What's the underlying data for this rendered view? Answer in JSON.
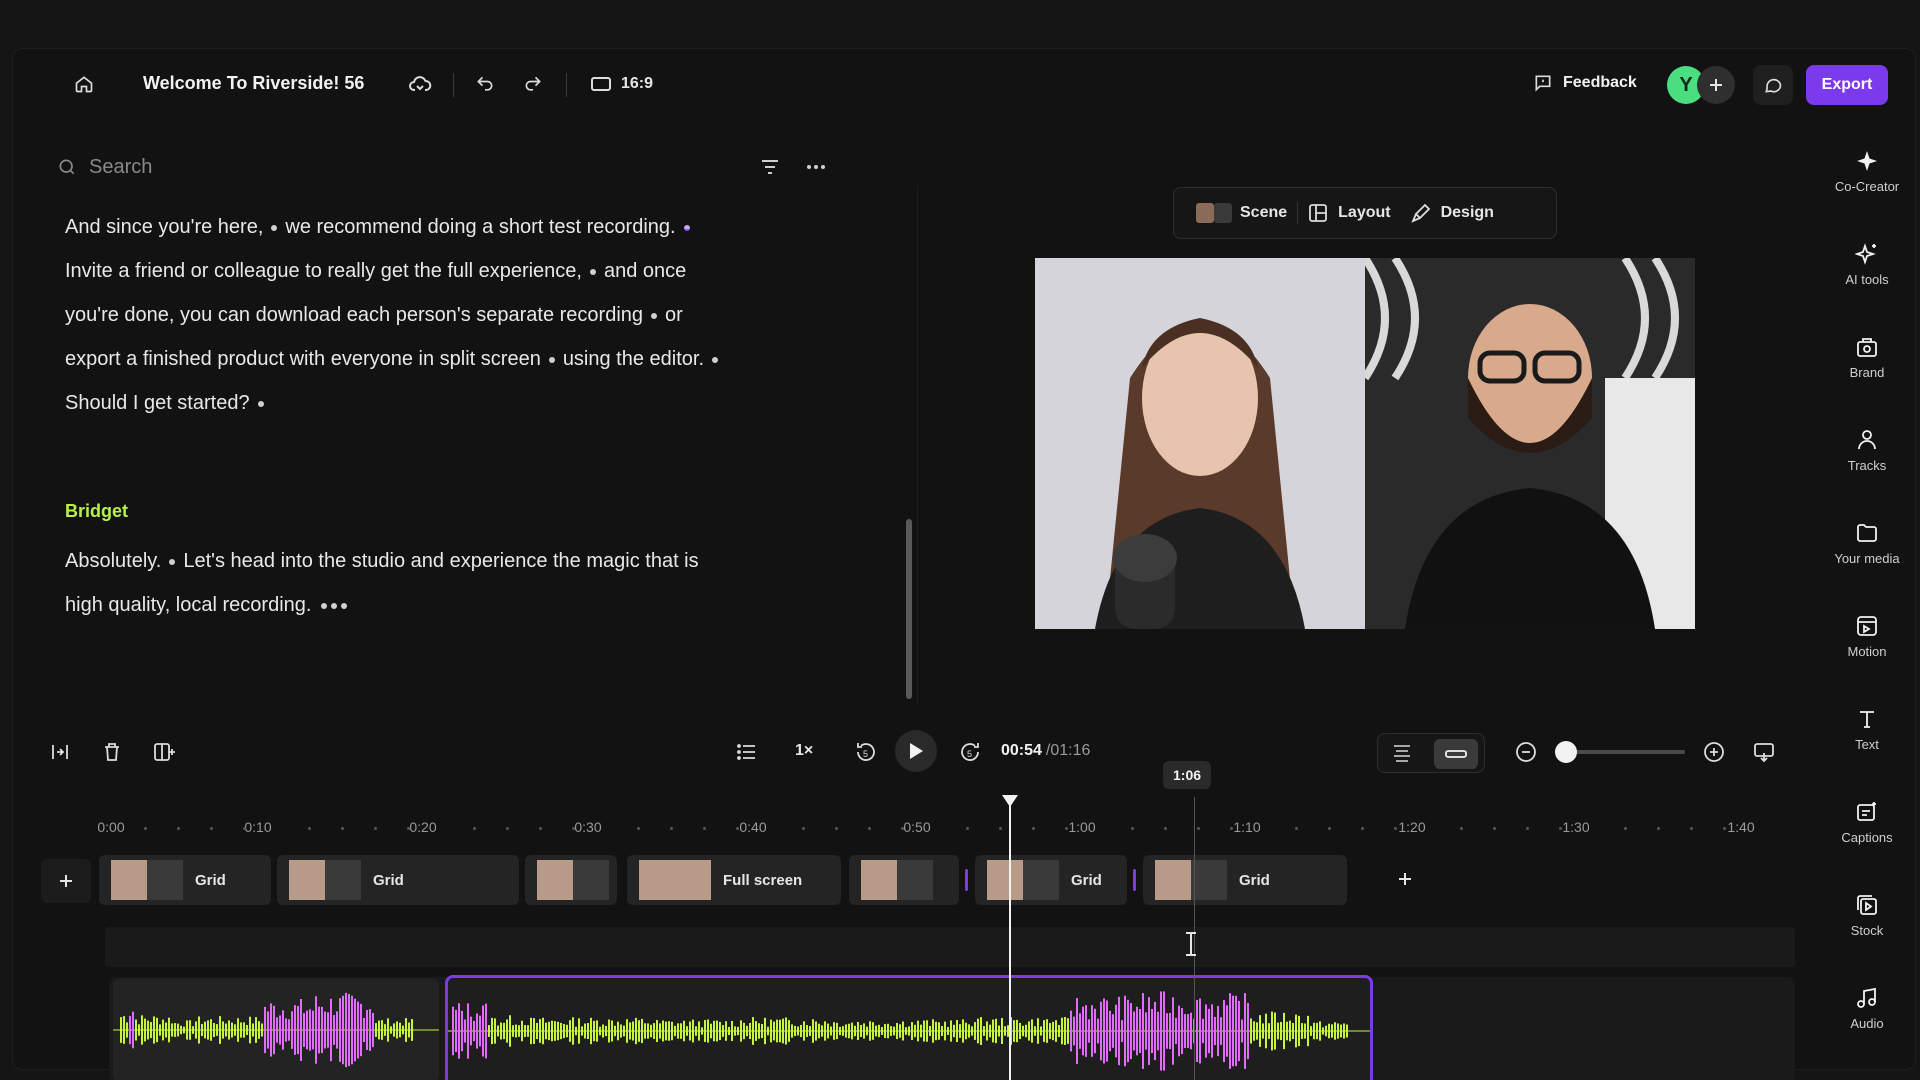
{
  "topbar": {
    "project_title": "Welcome To Riverside! 56",
    "aspect_ratio": "16:9",
    "feedback_label": "Feedback",
    "avatar_initial": "Y",
    "export_label": "Export"
  },
  "transcript": {
    "search_placeholder": "Search",
    "para1": {
      "l1": [
        "And since you're here,",
        "we recommend doing a short test recording."
      ],
      "l2": [
        "Invite a friend or colleague to really get the full experience,",
        "and once"
      ],
      "l3": [
        "you're done, you can download each person's separate recording",
        "or"
      ],
      "l4": [
        "export a finished product with everyone in split screen",
        "using the editor."
      ],
      "l5": [
        "Should I get started?"
      ]
    },
    "speaker": "Bridget",
    "para2": {
      "l1": [
        "Absolutely.",
        "Let's head into the studio and experience the magic that is"
      ],
      "l2": [
        "high quality, local recording."
      ]
    }
  },
  "scene_tabs": {
    "scene": "Scene",
    "layout": "Layout",
    "design": "Design"
  },
  "sidebar": {
    "items": [
      {
        "label": "Co-Creator",
        "icon": "sparkle-icon"
      },
      {
        "label": "AI tools",
        "icon": "ai-sparkles-icon"
      },
      {
        "label": "Brand",
        "icon": "brand-kit-icon"
      },
      {
        "label": "Tracks",
        "icon": "people-icon"
      },
      {
        "label": "Your media",
        "icon": "folder-icon"
      },
      {
        "label": "Motion",
        "icon": "motion-icon"
      },
      {
        "label": "Text",
        "icon": "text-icon"
      },
      {
        "label": "Captions",
        "icon": "captions-icon"
      },
      {
        "label": "Stock",
        "icon": "stock-icon"
      },
      {
        "label": "Audio",
        "icon": "music-note-icon"
      }
    ]
  },
  "controls": {
    "speed": "1×",
    "skip_back": "5",
    "skip_forward": "5",
    "current_time": "00:54",
    "total_time": "/01:16",
    "hover_time": "1:06",
    "zoom_level": 0.08
  },
  "timeline": {
    "ruler": [
      "0:00",
      "0:10",
      "0:20",
      "0:30",
      "0:40",
      "0:50",
      "1:00",
      "1:10",
      "1:20",
      "1:30",
      "1:40"
    ],
    "clips": [
      {
        "label": "Grid"
      },
      {
        "label": "Grid"
      },
      {
        "label": ""
      },
      {
        "label": "Full screen"
      },
      {
        "label": ""
      },
      {
        "label": "Grid"
      },
      {
        "label": "Grid"
      }
    ]
  },
  "colors": {
    "accent": "#7c3aed",
    "speaker_green": "#b6f24a",
    "waveform_green": "#c6f53a",
    "waveform_pink": "#e36bff"
  }
}
